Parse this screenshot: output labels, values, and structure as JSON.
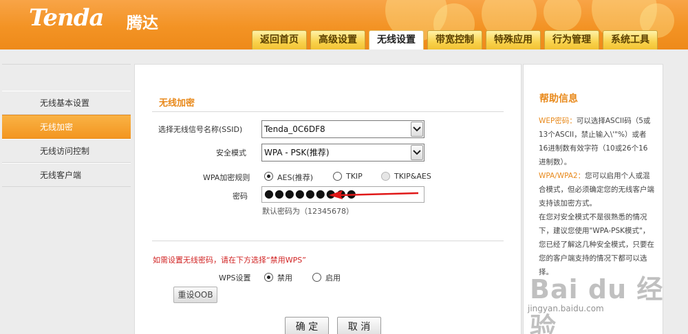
{
  "brand": {
    "logo": "Tenda",
    "logo_cn": "腾达"
  },
  "nav": {
    "tabs": [
      "返回首页",
      "高级设置",
      "无线设置",
      "带宽控制",
      "特殊应用",
      "行为管理",
      "系统工具"
    ],
    "active_index": 2
  },
  "sidebar": {
    "items": [
      "无线基本设置",
      "无线加密",
      "无线访问控制",
      "无线客户端"
    ],
    "active_index": 1
  },
  "main": {
    "section_title": "无线加密",
    "ssid_label": "选择无线信号名称(SSID)",
    "ssid_value": "Tenda_0C6DF8",
    "security_label": "安全模式",
    "security_value": "WPA - PSK(推荐)",
    "cipher_label": "WPA加密规则",
    "cipher_options": [
      "AES(推荐)",
      "TKIP",
      "TKIP&AES"
    ],
    "cipher_selected": "AES(推荐)",
    "password_label": "密码",
    "password_value": "●●●●●●●●●",
    "password_hint": "默认密码为（12345678）",
    "wps_note": "如需设置无线密码，请在下方选择“禁用WPS”",
    "wps_label": "WPS设置",
    "wps_options": [
      "禁用",
      "启用"
    ],
    "wps_selected": "禁用",
    "reset_oob_label": "重设OOB",
    "ok_label": "确 定",
    "cancel_label": "取 消"
  },
  "help": {
    "title": "帮助信息",
    "p1_key": "WEP密码：",
    "p1_text": "可以选择ASCII码（5或13个ASCII，禁止输入\\'\"%）或者16进制数有效字符（10或26个16进制数）。",
    "p2_key": "WPA/WPA2：",
    "p2_text": "您可以启用个人或混合模式，但必须确定您的无线客户端支持该加密方式。",
    "p3_text": "在您对安全模式不是很熟悉的情况下，建议您使用\"WPA-PSK模式\"，您已经了解这几种安全模式，只要在您的客户端支持的情况下都可以选择。"
  },
  "watermark": {
    "main": "Bai du 经验",
    "sub": "jingyan.baidu.com"
  },
  "colors": {
    "brand_orange": "#f39324",
    "accent_text": "#e8891b",
    "warning_red": "#d12424",
    "arrow_red": "#e01818"
  }
}
